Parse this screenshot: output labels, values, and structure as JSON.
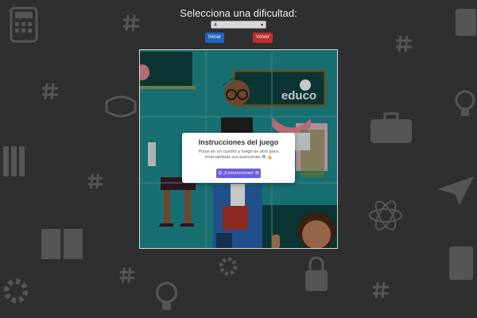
{
  "header": {
    "title": "Selecciona una dificultad:",
    "difficulty_selected": "4"
  },
  "buttons": {
    "start": "Iniciar",
    "back": "Volver"
  },
  "puzzle": {
    "logo_text": "educo"
  },
  "modal": {
    "title": "Instrucciones del juego",
    "text": "Pulsa en un cuadro y luego en otro para intercambiar sus posiciones 😎 👍",
    "button": "😍 ¡Comencemos! 😍"
  },
  "colors": {
    "background": "#2f2f2f",
    "start_button": "#1f63c4",
    "back_button": "#bf2d2d",
    "modal_button": "#6d5fd9",
    "puzzle_bg": "#1f8f93"
  }
}
